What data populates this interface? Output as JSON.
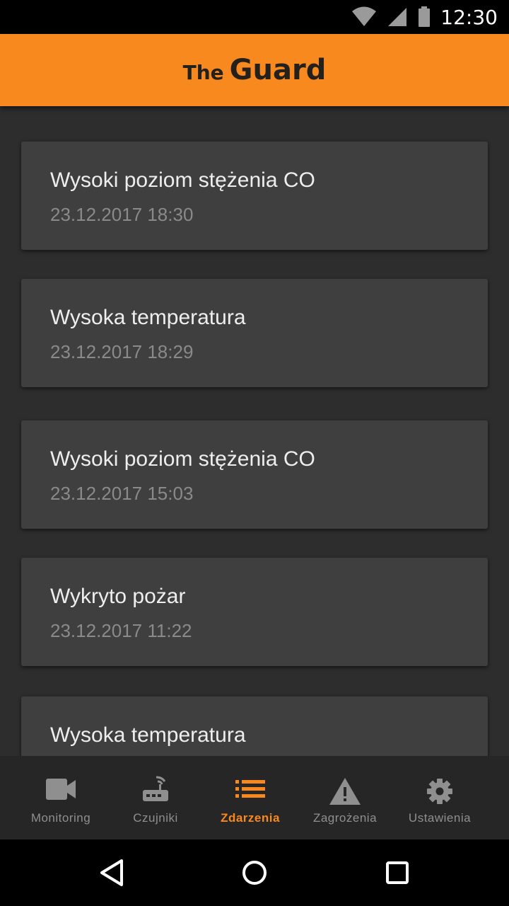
{
  "status_bar": {
    "time": "12:30",
    "icons": [
      "wifi-icon",
      "signal-icon",
      "battery-icon"
    ]
  },
  "app_bar": {
    "brand_the": "The",
    "brand_guard": "Guard",
    "color": "#f7891e"
  },
  "events": [
    {
      "title": "Wysoki poziom stężenia CO",
      "time": "23.12.2017 18:30"
    },
    {
      "title": "Wysoka temperatura",
      "time": "23.12.2017 18:29"
    },
    {
      "title": "Wysoki poziom stężenia CO",
      "time": "23.12.2017 15:03"
    },
    {
      "title": "Wykryto pożar",
      "time": "23.12.2017 11:22"
    },
    {
      "title": "Wysoka temperatura",
      "time": ""
    }
  ],
  "bottom_nav": {
    "items": [
      {
        "label": "Monitoring",
        "icon": "video-camera-icon"
      },
      {
        "label": "Czujniki",
        "icon": "router-icon"
      },
      {
        "label": "Zdarzenia",
        "icon": "list-icon",
        "active": true
      },
      {
        "label": "Zagrożenia",
        "icon": "warning-icon"
      },
      {
        "label": "Ustawienia",
        "icon": "gear-icon"
      }
    ],
    "active_color": "#f7891e"
  },
  "system_nav": {
    "buttons": [
      "back-icon",
      "home-icon",
      "recents-icon"
    ]
  }
}
